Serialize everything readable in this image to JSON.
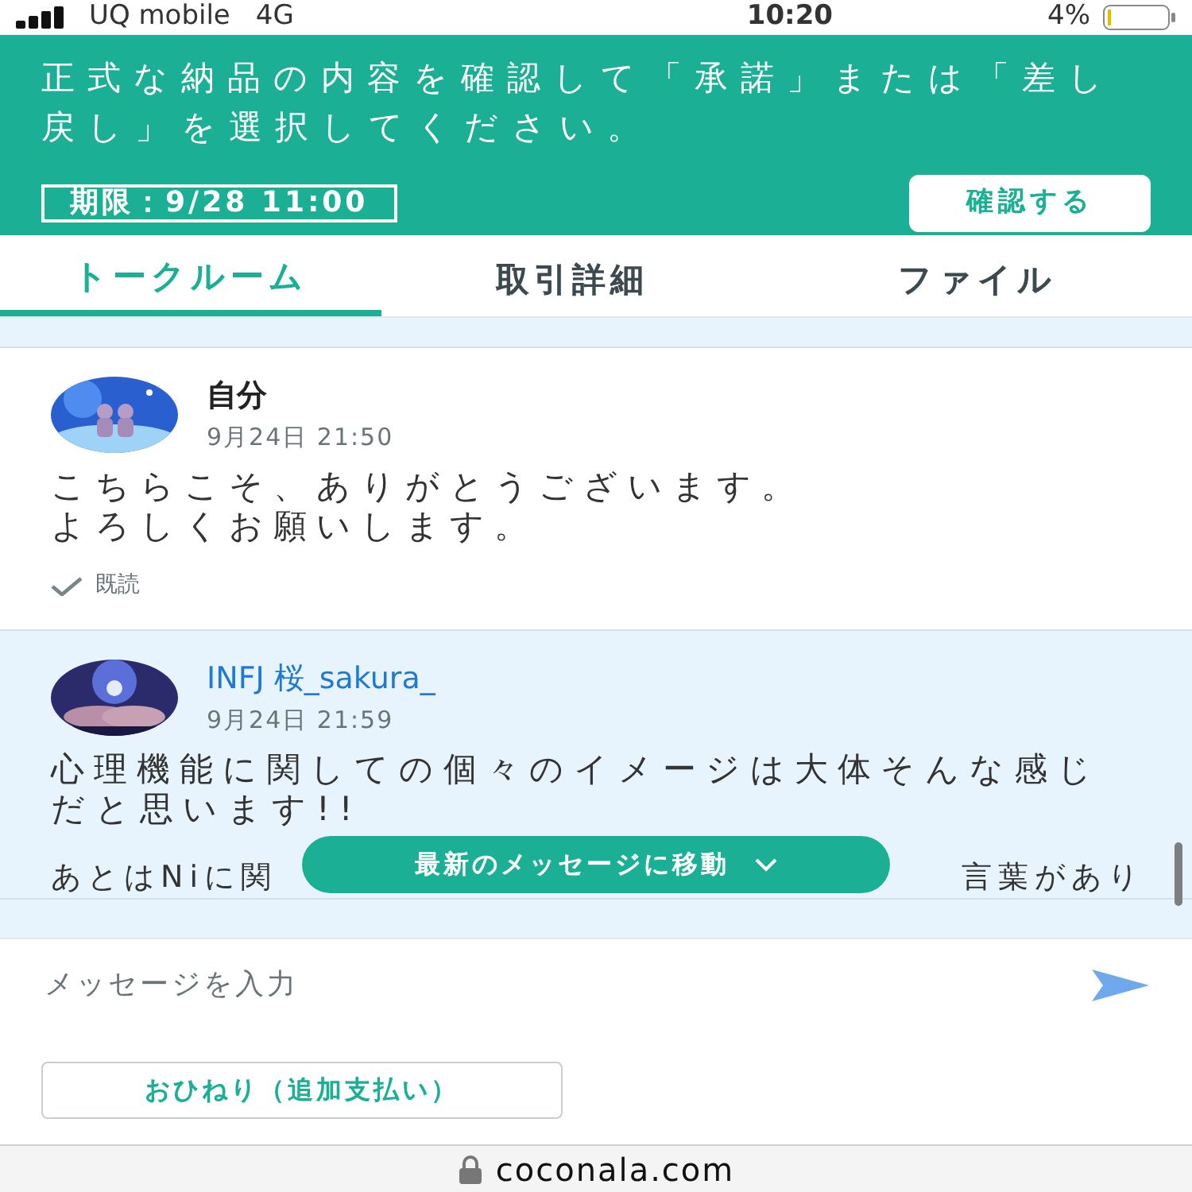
{
  "status_bar": {
    "carrier": "UQ mobile",
    "network": "4G",
    "time": "10:20",
    "battery": "4%"
  },
  "banner": {
    "message": "正式な納品の内容を確認して「承諾」または「差し戻し」を選択してください。",
    "deadline": "期限：9/28 11:00",
    "button": "確認する"
  },
  "tabs": [
    {
      "label": "トークルーム",
      "selected": true
    },
    {
      "label": "取引詳細",
      "selected": false
    },
    {
      "label": "ファイル",
      "selected": false
    }
  ],
  "messages": [
    {
      "kind": "own",
      "sender": "自分",
      "time": "9月24日 21:50",
      "paragraphs": [
        [
          [
            "こちらこそ、ありがとうございます。"
          ],
          [
            "よろしくお願いします。"
          ]
        ]
      ],
      "read_label": "既読"
    },
    {
      "kind": "partner",
      "sender": "INFJ 桜_sakura_",
      "time": "9月24日 21:59",
      "paragraphs": [
        [
          [
            "心理機能に関しての個々のイメージは大体そんな感じだと思います!!"
          ]
        ],
        [
          [
            "あとはNiに関",
            "言葉があり"
          ]
        ]
      ]
    }
  ],
  "jump_button": "最新のメッセージに移動",
  "composer": {
    "placeholder": "メッセージを入力",
    "tip_button": "おひねり（追加支払い）"
  },
  "address_bar": {
    "url": "coconala.com"
  }
}
